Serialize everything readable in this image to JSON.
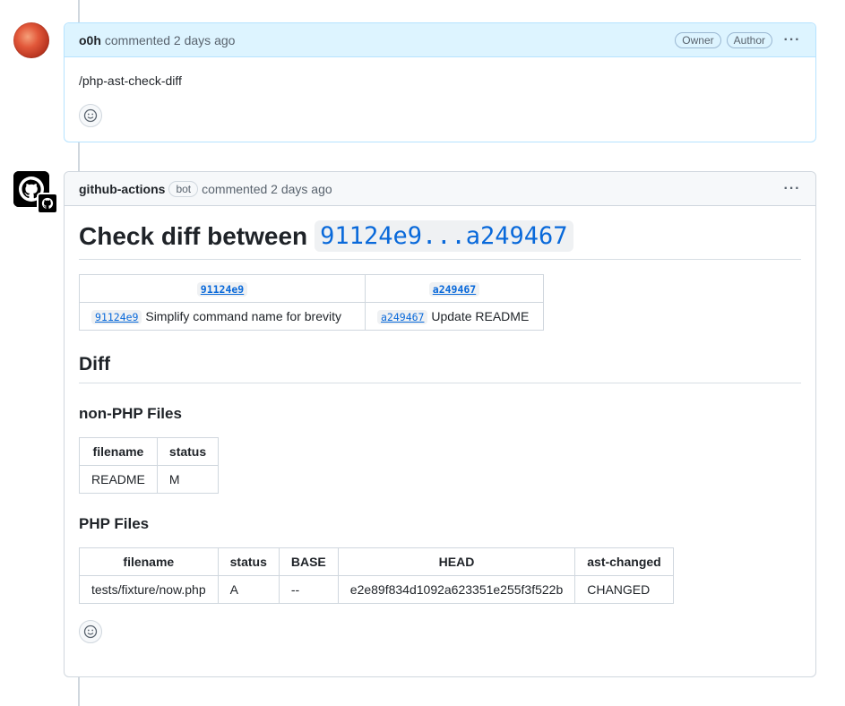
{
  "comments": [
    {
      "author": "o0h",
      "meta": "commented 2 days ago",
      "labels": [
        "Owner",
        "Author"
      ],
      "body": "/php-ast-check-diff"
    },
    {
      "author": "github-actions",
      "bot_label": "bot",
      "meta": "commented 2 days ago",
      "heading_prefix": "Check diff between",
      "heading_code": "91124e9...a249467",
      "commit_table": {
        "headers": [
          "91124e9",
          "a249467"
        ],
        "row": [
          {
            "sha": "91124e9",
            "message": "Simplify command name for brevity"
          },
          {
            "sha": "a249467",
            "message": "Update README"
          }
        ]
      },
      "diff_heading": "Diff",
      "non_php_heading": "non-PHP Files",
      "non_php_table": {
        "headers": [
          "filename",
          "status"
        ],
        "rows": [
          [
            "README",
            "M"
          ]
        ]
      },
      "php_heading": "PHP Files",
      "php_table": {
        "headers": [
          "filename",
          "status",
          "BASE",
          "HEAD",
          "ast-changed"
        ],
        "rows": [
          [
            "tests/fixture/now.php",
            "A",
            "--",
            "e2e89f834d1092a623351e255f3f522b",
            "CHANGED"
          ]
        ]
      }
    }
  ],
  "icons": [
    "smiley-icon",
    "kebab-icon",
    "github-logo-icon"
  ],
  "colors": {
    "link": "#0969da",
    "owner_header": "#ddf4ff",
    "owner_border": "#b6e3ff"
  }
}
